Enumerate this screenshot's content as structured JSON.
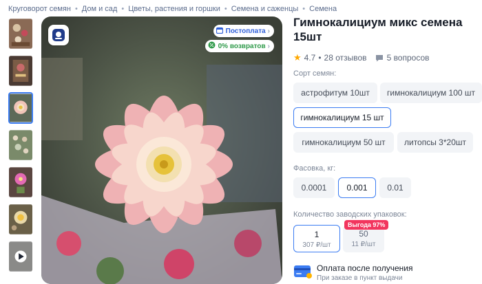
{
  "breadcrumb": [
    "Круговорот семян",
    "Дом и сад",
    "Цветы, растения и горшки",
    "Семена и саженцы",
    "Семена"
  ],
  "photo_badges": {
    "postpay": "Постоплата",
    "returns": "0% возвратов"
  },
  "product": {
    "title": "Гимнокалициум микс семена 15шт",
    "rating": "4.7",
    "reviews": "28 отзывов",
    "questions": "5 вопросов"
  },
  "variety": {
    "label": "Сорт семян:",
    "options": [
      "астрофитум 10шт",
      "гимнокалициум 100 шт",
      "гимнокалициум 15 шт",
      "гимнокалициум 50 шт",
      "литопсы 3*20шт"
    ],
    "selected": "гимнокалициум 15 шт"
  },
  "packing": {
    "label": "Фасовка, кг:",
    "options": [
      "0.0001",
      "0.001",
      "0.01"
    ],
    "selected": "0.001"
  },
  "quantity": {
    "label": "Количество заводских упаковок:",
    "options": [
      {
        "count": "1",
        "price": "307 ₽/шт",
        "badge": ""
      },
      {
        "count": "50",
        "price": "11 ₽/шт",
        "badge": "Выгода 97%"
      }
    ],
    "selected": "1"
  },
  "payment": {
    "title": "Оплата после получения",
    "subtitle": "При заказе в пункт выдачи"
  },
  "colors": {
    "accent": "#3b7cf2",
    "deal": "#f2355e",
    "star": "#ffa800",
    "returns": "#2f9a4a"
  },
  "icons": [
    "brand-logo-icon",
    "calendar-icon",
    "percent-icon",
    "star-icon",
    "chat-icon",
    "play-icon",
    "card-icon"
  ]
}
